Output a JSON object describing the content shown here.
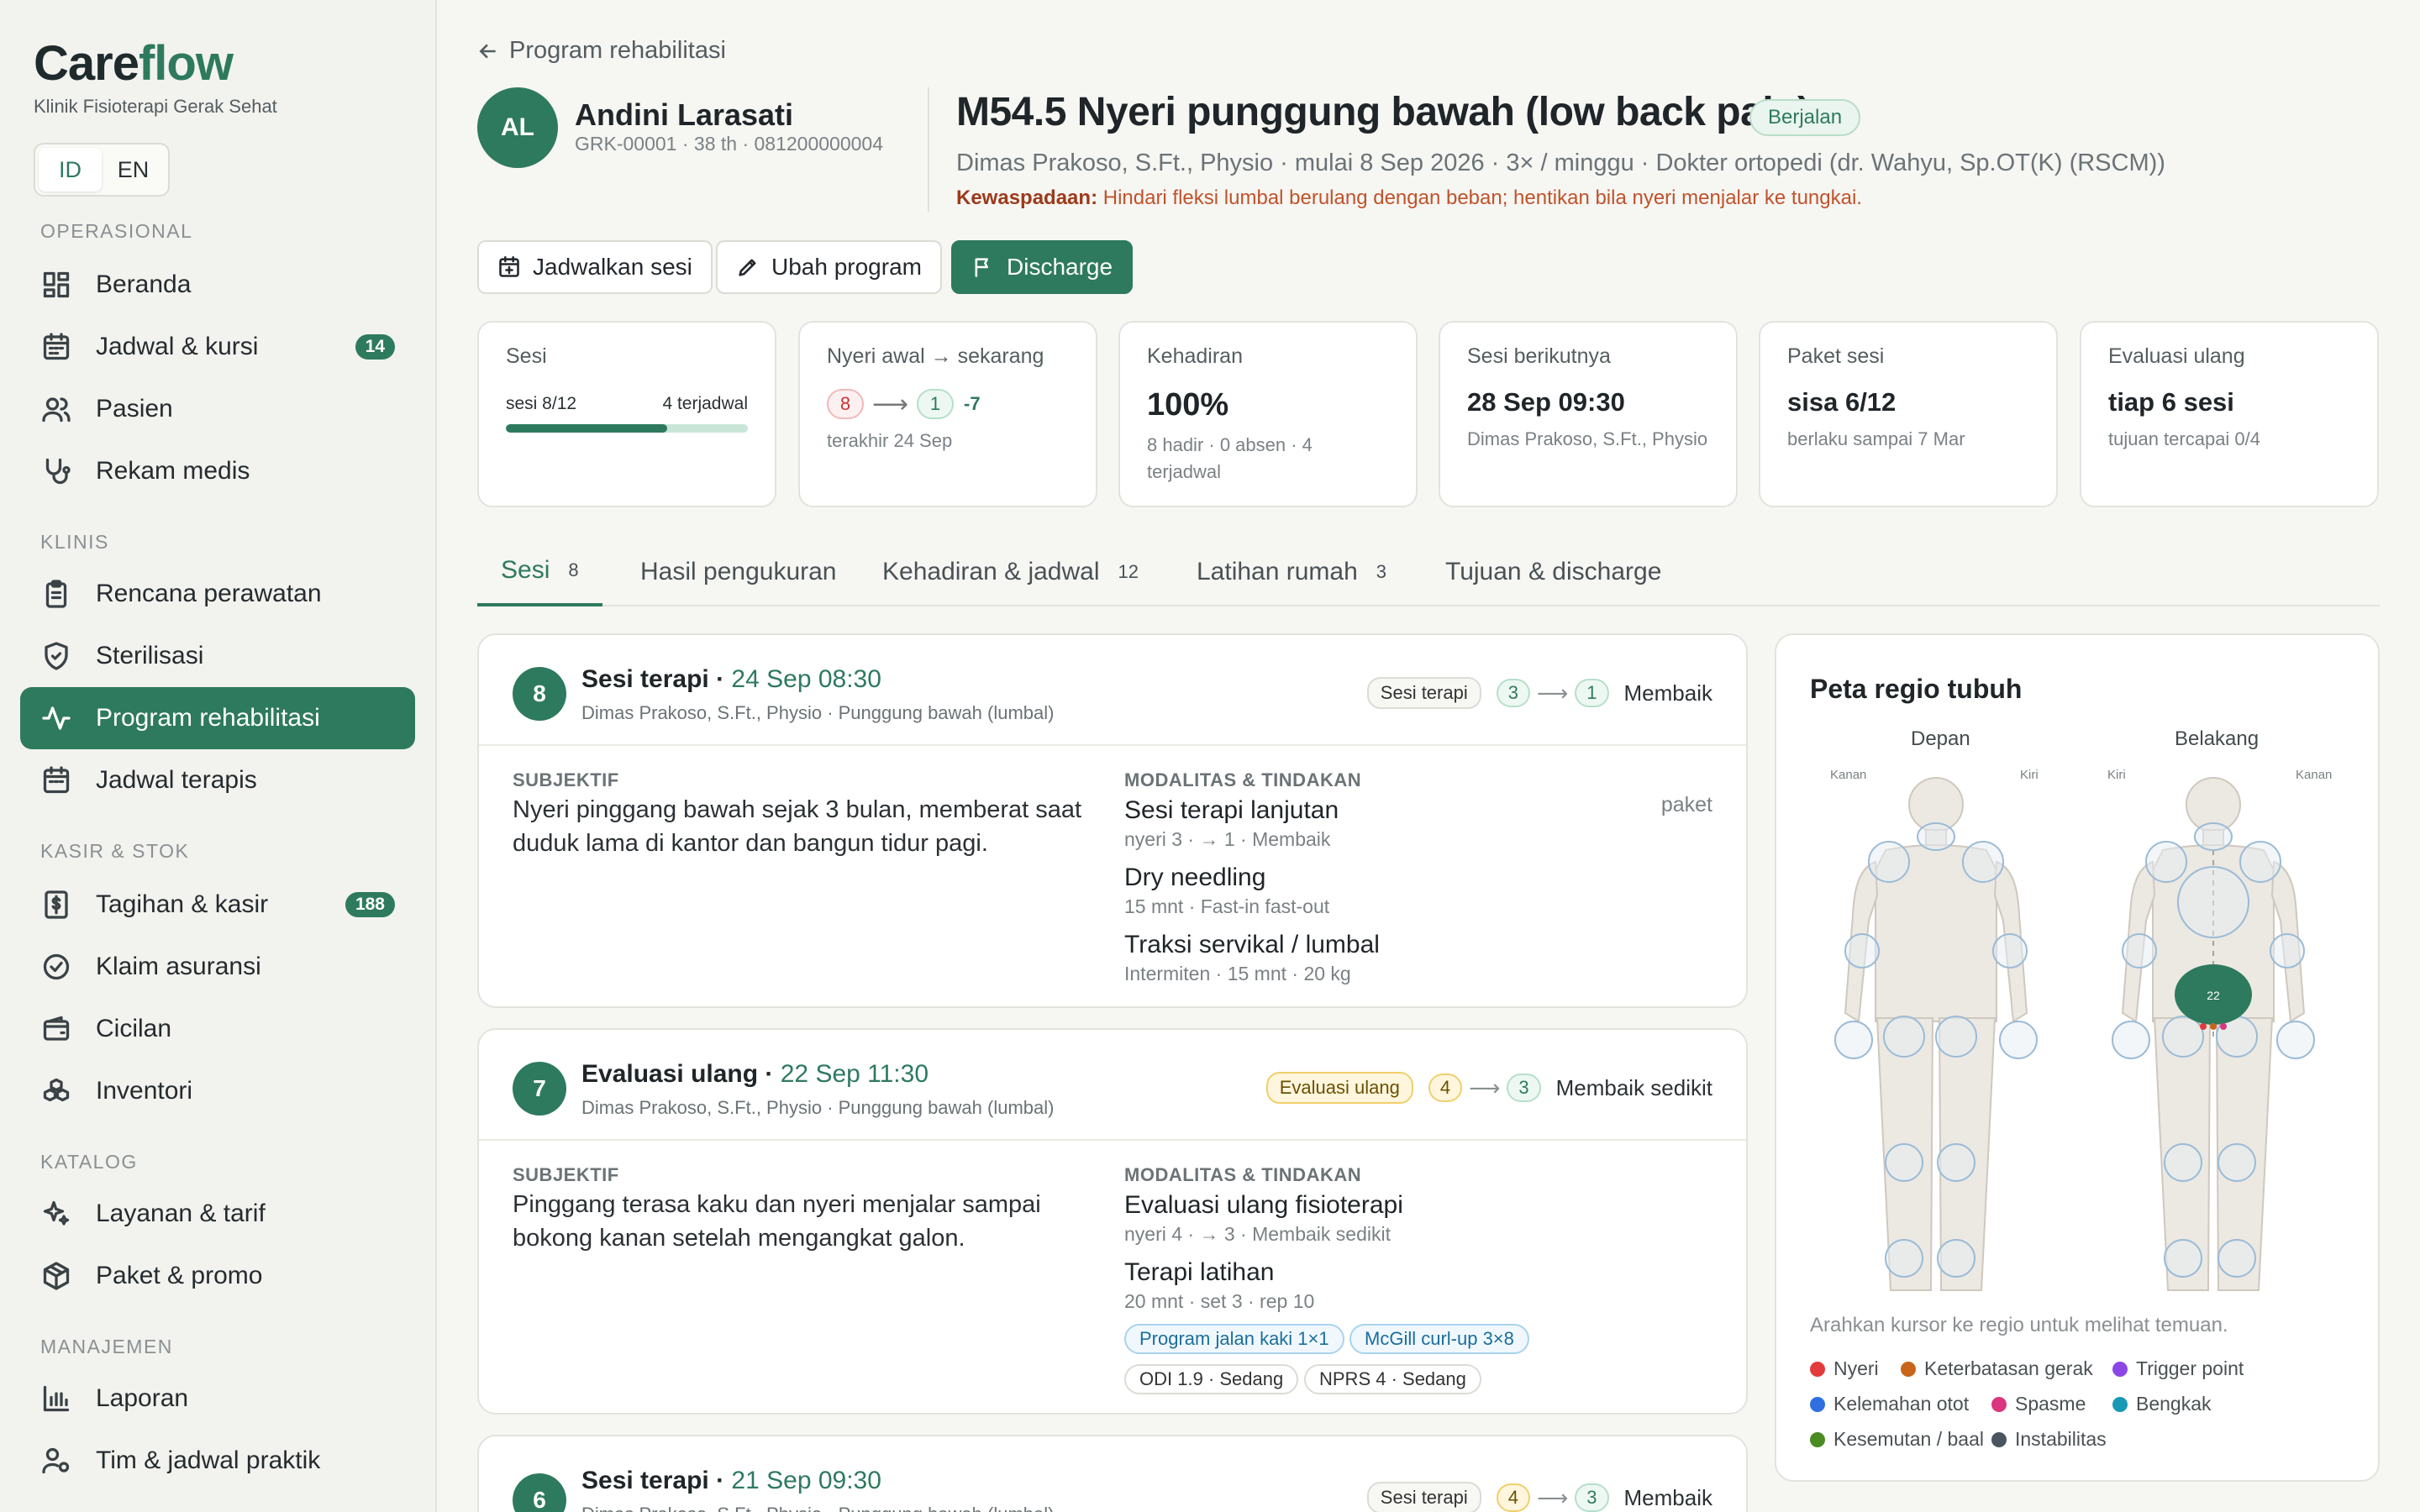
{
  "brand": {
    "name_a": "Care",
    "name_b": "flow",
    "clinic": "Klinik Fisioterapi Gerak Sehat"
  },
  "lang": {
    "id": "ID",
    "en": "EN",
    "active": "ID"
  },
  "sidebar": {
    "sections": [
      "OPERASIONAL",
      "KLINIS",
      "KASIR & STOK",
      "KATALOG",
      "MANAJEMEN"
    ],
    "items": [
      {
        "label": "Beranda",
        "icon": "dashboard-icon"
      },
      {
        "label": "Jadwal & kursi",
        "icon": "calendar-icon",
        "badge": "14"
      },
      {
        "label": "Pasien",
        "icon": "users-icon"
      },
      {
        "label": "Rekam medis",
        "icon": "stethoscope-icon"
      },
      {
        "label": "Rencana perawatan",
        "icon": "clipboard-icon"
      },
      {
        "label": "Sterilisasi",
        "icon": "shield-icon"
      },
      {
        "label": "Program rehabilitasi",
        "icon": "activity-icon",
        "active": true
      },
      {
        "label": "Jadwal terapis",
        "icon": "calendar-icon"
      },
      {
        "label": "Tagihan & kasir",
        "icon": "dollar-icon",
        "badge": "188"
      },
      {
        "label": "Klaim asuransi",
        "icon": "check-circle-icon"
      },
      {
        "label": "Cicilan",
        "icon": "wallet-icon"
      },
      {
        "label": "Inventori",
        "icon": "boxes-icon"
      },
      {
        "label": "Layanan & tarif",
        "icon": "sparkles-icon"
      },
      {
        "label": "Paket & promo",
        "icon": "package-icon"
      },
      {
        "label": "Laporan",
        "icon": "bar-chart-icon"
      },
      {
        "label": "Tim & jadwal praktik",
        "icon": "user-cog-icon"
      }
    ]
  },
  "header": {
    "back_label": "Program rehabilitasi",
    "avatar_initials": "AL",
    "patient_name": "Andini Larasati",
    "patient_meta": "GRK-00001 · 38 th · 081200000004",
    "diagnosis": "M54.5 Nyeri punggung bawah (low back pain)",
    "status": "Berjalan",
    "program_meta": "Dimas Prakoso, S.Ft., Physio · mulai 8 Sep 2026 · 3× / minggu · Dokter ortopedi (dr. Wahyu, Sp.OT(K) (RSCM))",
    "caution_label": "Kewaspadaan:",
    "caution_text": "Hindari fleksi lumbal berulang dengan beban; hentikan bila nyeri menjalar ke tungkai."
  },
  "actions": {
    "schedule": "Jadwalkan sesi",
    "edit": "Ubah program",
    "discharge": "Discharge"
  },
  "stats": {
    "sessions": {
      "label": "Sesi",
      "progress_text": "sesi 8/12",
      "scheduled": "4 terjadwal",
      "progress": 0.667
    },
    "pain": {
      "label": "Nyeri awal → sekarang",
      "from": "8",
      "to": "1",
      "delta": "-7",
      "sub": "terakhir 24 Sep"
    },
    "attendance": {
      "label": "Kehadiran",
      "value": "100%",
      "sub": "8 hadir · 0 absen · 4 terjadwal"
    },
    "next": {
      "label": "Sesi berikutnya",
      "value": "28 Sep 09:30",
      "sub": "Dimas Prakoso, S.Ft., Physio"
    },
    "package": {
      "label": "Paket sesi",
      "value": "sisa 6/12",
      "sub": "berlaku sampai 7 Mar"
    },
    "reeval": {
      "label": "Evaluasi ulang",
      "value": "tiap 6 sesi",
      "sub": "tujuan tercapai 0/4"
    }
  },
  "tabs": [
    {
      "label": "Sesi",
      "count": "8"
    },
    {
      "label": "Hasil pengukuran",
      "count": ""
    },
    {
      "label": "Kehadiran & jadwal",
      "count": "12"
    },
    {
      "label": "Latihan rumah",
      "count": "3"
    },
    {
      "label": "Tujuan & discharge",
      "count": ""
    }
  ],
  "sessions": [
    {
      "num": "8",
      "title": "Sesi terapi",
      "date": "24 Sep 08:30",
      "sub": "Dimas Prakoso, S.Ft., Physio · Punggung bawah (lumbal)",
      "type": "Sesi terapi",
      "from": "3",
      "to": "1",
      "verdict": "Membaik",
      "subj_label": "SUBJEKTIF",
      "mod_label": "MODALITAS & TINDAKAN",
      "subjective": "Nyeri pinggang bawah sejak 3 bulan, memberat saat duduk lama di kantor dan bangun tidur pagi.",
      "paket": "paket",
      "mods": [
        {
          "name": "Sesi terapi lanjutan",
          "detail": "nyeri 3 · → 1 · Membaik"
        },
        {
          "name": "Dry needling",
          "detail": "15 mnt · Fast-in fast-out"
        },
        {
          "name": "Traksi servikal / lumbal",
          "detail": "Intermiten · 15 mnt · 20 kg"
        }
      ]
    },
    {
      "num": "7",
      "title": "Evaluasi ulang",
      "date": "22 Sep 11:30",
      "sub": "Dimas Prakoso, S.Ft., Physio · Punggung bawah (lumbal)",
      "type": "Evaluasi ulang",
      "from": "4",
      "to": "3",
      "verdict": "Membaik sedikit",
      "subj_label": "SUBJEKTIF",
      "mod_label": "MODALITAS & TINDAKAN",
      "subjective": "Pinggang terasa kaku dan nyeri menjalar sampai bokong kanan setelah mengangkat galon.",
      "mods": [
        {
          "name": "Evaluasi ulang fisioterapi",
          "detail": "nyeri 4 · → 3 · Membaik sedikit"
        },
        {
          "name": "Terapi latihan",
          "detail": "20 mnt · set 3 · rep 10"
        }
      ],
      "chips_blue": [
        "Program jalan kaki 1×1",
        "McGill curl-up 3×8"
      ],
      "chips_gray": [
        "ODI 1.9 · Sedang",
        "NPRS 4 · Sedang"
      ]
    },
    {
      "num": "6",
      "title": "Sesi terapi",
      "date": "21 Sep 09:30",
      "sub": "Dimas Prakoso, S.Ft., Physio · Punggung bawah (lumbal)",
      "type": "Sesi terapi",
      "from": "4",
      "to": "3",
      "verdict": "Membaik"
    }
  ],
  "body_map": {
    "title": "Peta regio tubuh",
    "front": "Depan",
    "back": "Belakang",
    "front_right": "Kanan",
    "front_left": "Kiri",
    "back_left": "Kiri",
    "back_right": "Kanan",
    "lumbar_count": "22",
    "hint": "Arahkan kursor ke regio untuk melihat temuan.",
    "legend": [
      {
        "label": "Nyeri",
        "color": "#e23b3b"
      },
      {
        "label": "Keterbatasan gerak",
        "color": "#c8651b"
      },
      {
        "label": "Trigger point",
        "color": "#8b47e6"
      },
      {
        "label": "Kelemahan otot",
        "color": "#2f6fe0"
      },
      {
        "label": "Spasme",
        "color": "#d9367f"
      },
      {
        "label": "Bengkak",
        "color": "#1799b5"
      },
      {
        "label": "Kesemutan / baal",
        "color": "#4c8a22"
      },
      {
        "label": "Instabilitas",
        "color": "#4a5560"
      }
    ]
  }
}
